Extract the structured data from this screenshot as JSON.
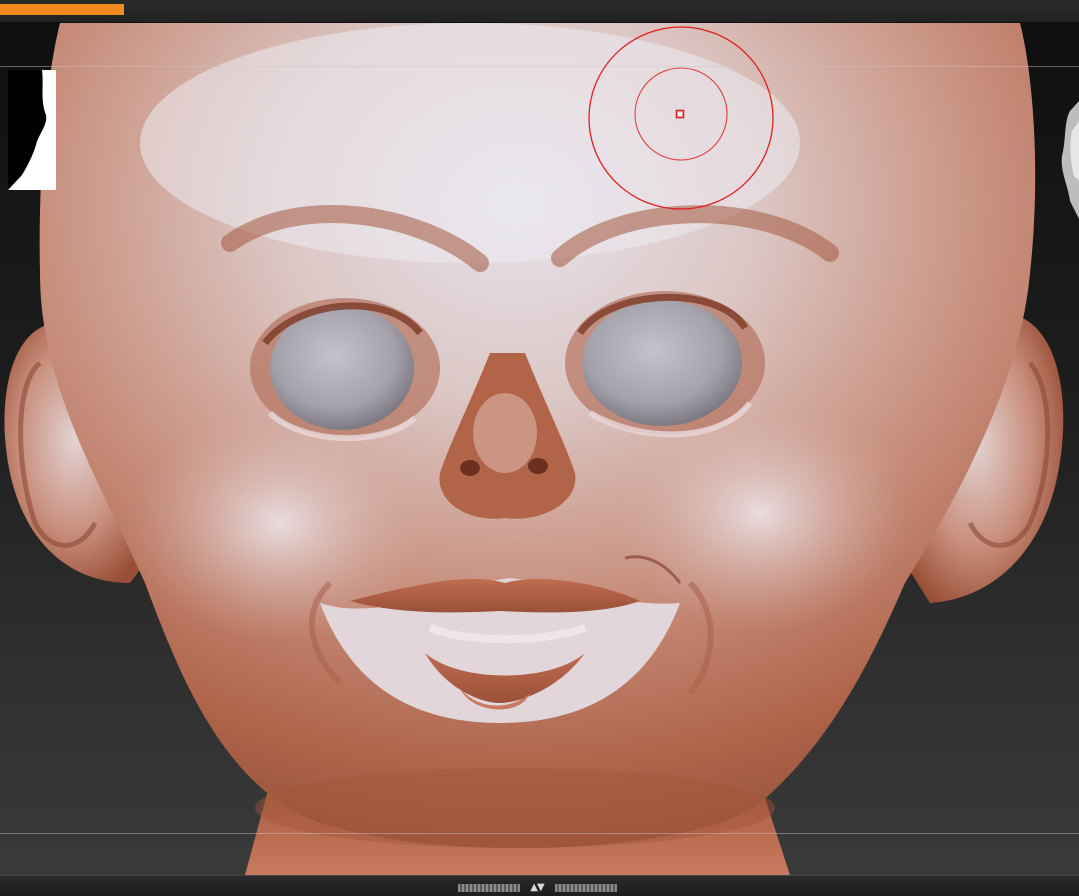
{
  "app": {
    "progress_fraction": 0.115,
    "accent_color": "#f08a1c",
    "brush_cursor_color": "#e02020",
    "skin_color": "#b86a52",
    "eye_color": "#a6a4ad"
  },
  "viewport": {
    "content": "sculpted-head-model"
  },
  "bottom_bar": {
    "toggle_glyph": "▲▼"
  },
  "icons": {
    "toggle": "expand-collapse-icon"
  }
}
